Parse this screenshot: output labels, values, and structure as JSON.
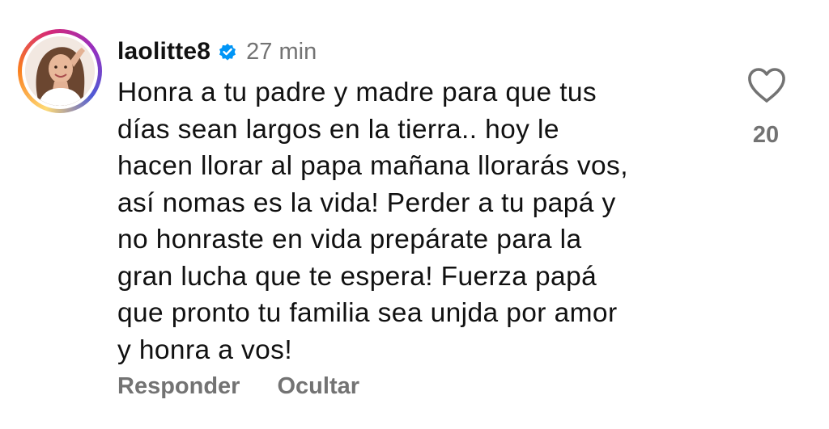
{
  "comment": {
    "username": "laolitte8",
    "verified_icon": "verified-badge-icon",
    "time": "27 min",
    "text": "Honra a tu padre y madre para que tus\ndías sean largos en la tierra.. hoy le\nhacen llorar al papa mañana llorarás vos,\nasí nomas es la vida! Perder a tu papá y\nno honraste en vida prepárate para la\ngran lucha que te espera! Fuerza papá\nque pronto tu familia sea unjda por amor\ny honra a vos!",
    "like_icon": "heart-icon",
    "like_count": "20",
    "reply_label": "Responder",
    "hide_label": "Ocultar"
  },
  "colors": {
    "text": "#111111",
    "secondary": "#737373",
    "verified": "#0095f6",
    "background": "#ffffff"
  }
}
